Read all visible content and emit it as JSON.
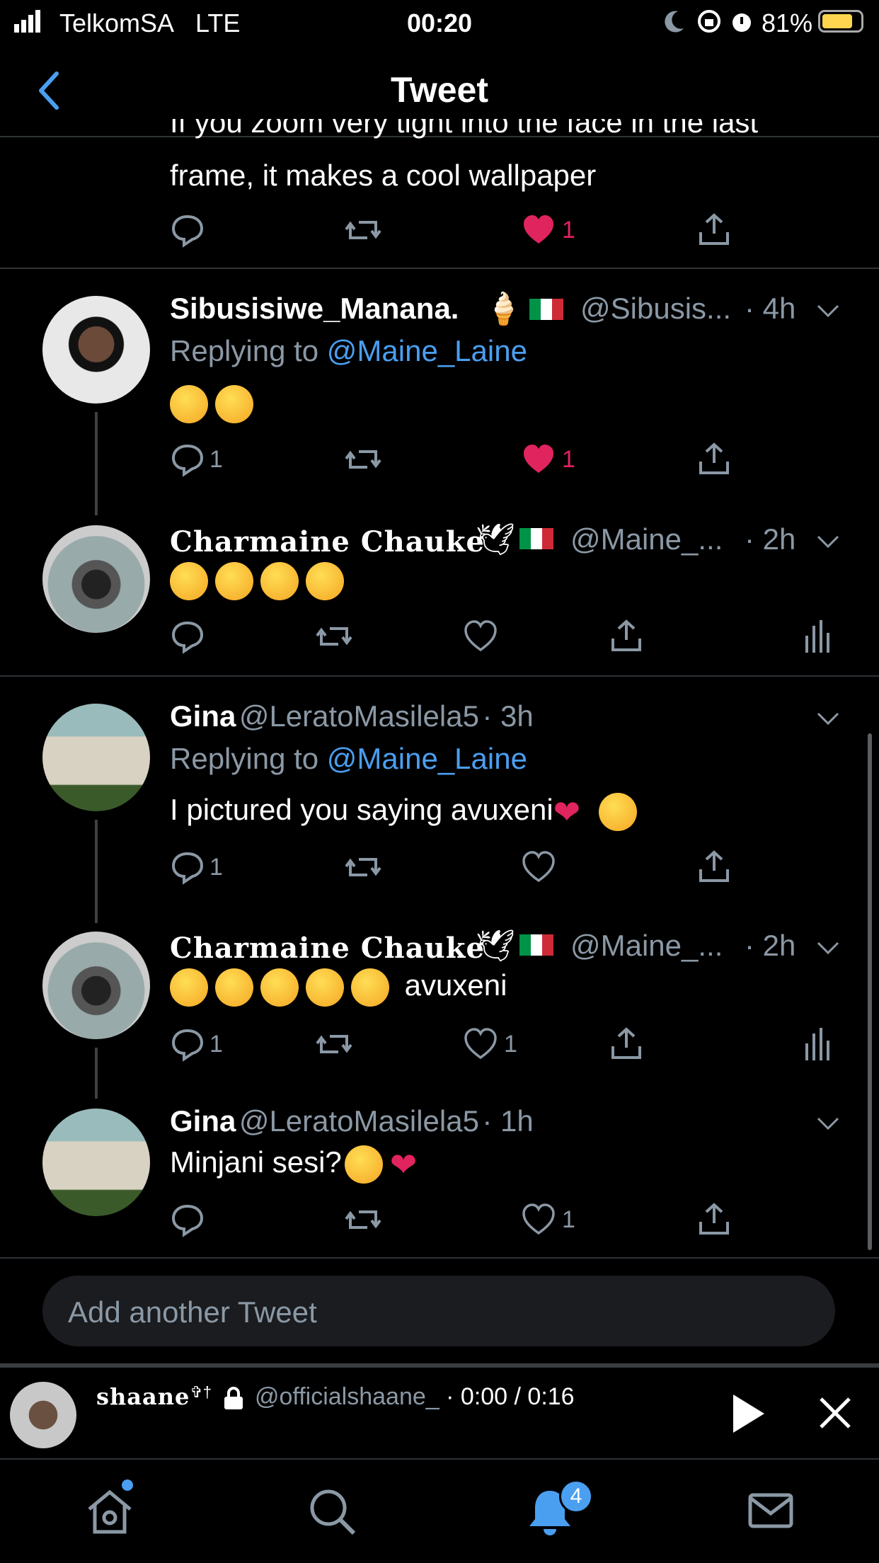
{
  "status_bar": {
    "carrier": "TelkomSA",
    "network": "LTE",
    "time": "00:20",
    "battery": "81%",
    "battery_level": 0.81
  },
  "header": {
    "title": "Tweet"
  },
  "top_tweet": {
    "text_partial": "If you zoom very tight into the face in the last",
    "text_line2": "frame, it makes a cool wallpaper",
    "likes": "1"
  },
  "replies": [
    {
      "name": "Sibusisiwe_Manana.",
      "handle": "@Sibusis...",
      "time": "· 4h",
      "replying_prefix": "Replying to",
      "replying_to": "@Maine_Laine",
      "text": "",
      "emoji_count": 2,
      "reply_count": "1",
      "like_count": "1"
    },
    {
      "name": "Charmaine Chauke",
      "handle": "@Maine_...",
      "time": "· 2h",
      "emoji_count": 4
    },
    {
      "name": "Gina",
      "handle": "@LeratoMasilela5",
      "time": "· 3h",
      "replying_prefix": "Replying to",
      "replying_to": "@Maine_Laine",
      "text": "I pictured you saying avuxeni",
      "reply_count": "1"
    },
    {
      "name": "Charmaine Chauke",
      "handle": "@Maine_...",
      "time": "· 2h",
      "text": "avuxeni",
      "emoji_count": 5,
      "reply_count": "1",
      "like_count": "1"
    },
    {
      "name": "Gina",
      "handle": "@LeratoMasilela5",
      "time": "· 1h",
      "text": "Minjani sesi?",
      "like_count": "1"
    }
  ],
  "compose": {
    "placeholder": "Add another Tweet"
  },
  "media_bar": {
    "name": "shaane",
    "handle": "@officialshaane_",
    "progress": "· 0:00 / 0:16"
  },
  "nav": {
    "notification_count": "4"
  },
  "colors": {
    "accent": "#4a9ff0",
    "like": "#e0245e",
    "divider": "#2f3336",
    "muted": "#8b98a5"
  }
}
